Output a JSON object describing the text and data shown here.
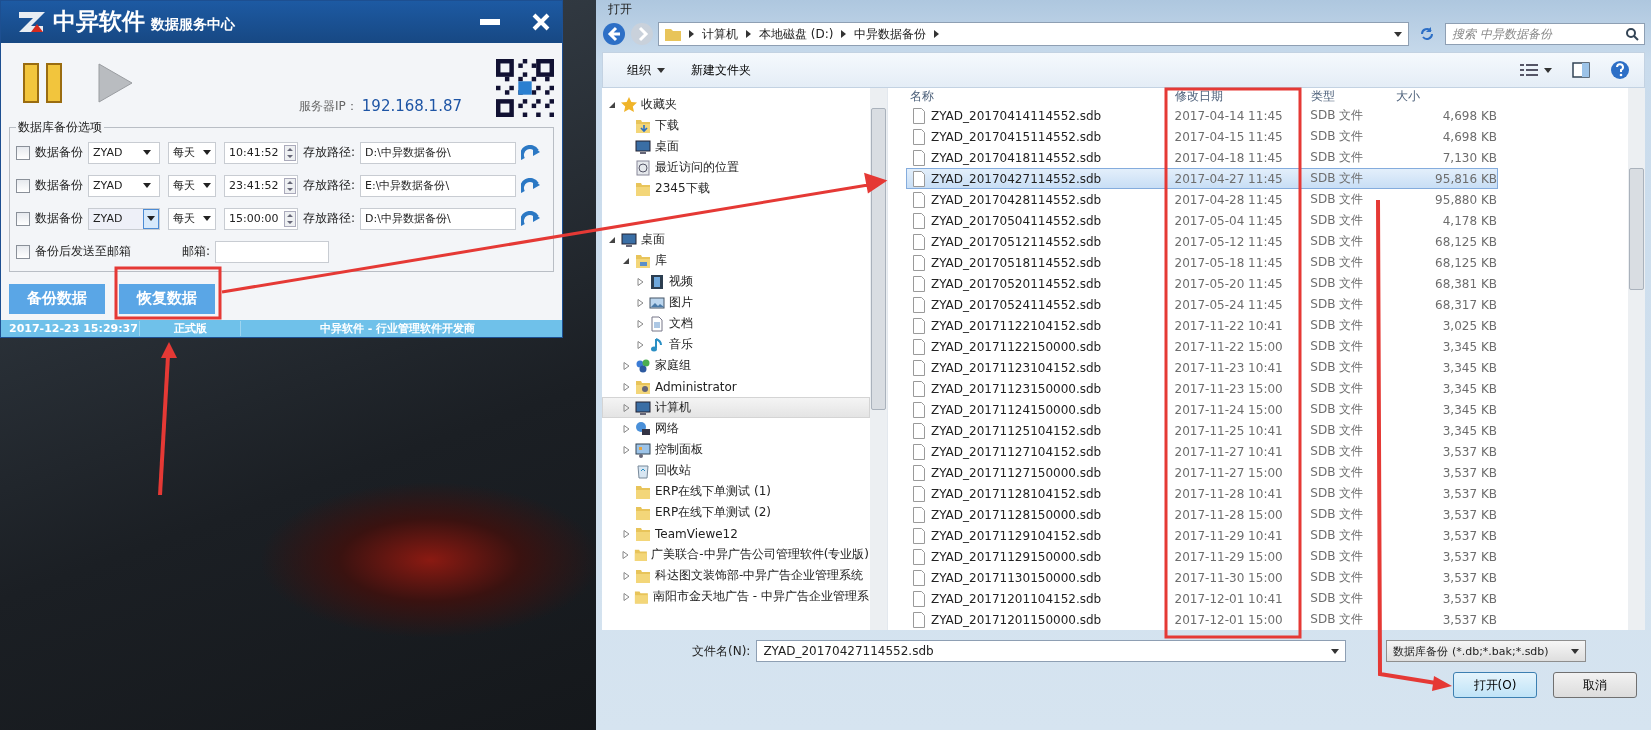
{
  "app_window": {
    "logo_text": "中异软件",
    "subtitle": "数据服务中心",
    "server_ip_label": "服务器IP：",
    "server_ip": "192.168.1.87",
    "group_title": "数据库备份选项",
    "backup_rows": [
      {
        "checked": false,
        "label": "数据备份",
        "database": "ZYAD",
        "combo_focused": false,
        "frequency": "每天",
        "time": "10:41:52",
        "path_label": "存放路径:",
        "path": "D:\\中异数据备份\\"
      },
      {
        "checked": false,
        "label": "数据备份",
        "database": "ZYAD",
        "combo_focused": false,
        "frequency": "每天",
        "time": "23:41:52",
        "path_label": "存放路径:",
        "path": "E:\\中异数据备份\\"
      },
      {
        "checked": false,
        "label": "数据备份",
        "database": "ZYAD",
        "combo_focused": true,
        "frequency": "每天",
        "time": "15:00:00",
        "path_label": "存放路径:",
        "path": "D:\\中异数据备份\\"
      }
    ],
    "email_option": {
      "checked": false,
      "label": "备份后发送至邮箱"
    },
    "email_label": "邮箱:",
    "buttons": [
      "备份数据",
      "恢复数据"
    ],
    "status_bar": [
      "2017-12-23 15:29:37",
      "正式版",
      "中异软件 - 行业管理软件开发商"
    ]
  },
  "dialog": {
    "title": "打开",
    "breadcrumb": [
      "计算机",
      "本地磁盘 (D:)",
      "中异数据备份"
    ],
    "search_placeholder": "搜索 中异数据备份",
    "toolbar": [
      "组织",
      "新建文件夹"
    ],
    "nav_tree": [
      {
        "label": "收藏夹",
        "kind": "star",
        "expanded": true,
        "selected": false,
        "children": [
          {
            "label": "下载",
            "kind": "download",
            "selected": false
          },
          {
            "label": "桌面",
            "kind": "desktop",
            "selected": false
          },
          {
            "label": "最近访问的位置",
            "kind": "recent",
            "selected": false
          },
          {
            "label": "2345下载",
            "kind": "folder",
            "selected": false
          }
        ]
      },
      {
        "label": "桌面",
        "kind": "desktop",
        "expanded": true,
        "selected": false,
        "children": [
          {
            "label": "库",
            "kind": "library",
            "expanded": true,
            "selected": false,
            "children": [
              {
                "label": "视频",
                "kind": "video",
                "expanded": false,
                "selected": false
              },
              {
                "label": "图片",
                "kind": "picture",
                "expanded": false,
                "selected": false
              },
              {
                "label": "文档",
                "kind": "document",
                "expanded": false,
                "selected": false
              },
              {
                "label": "音乐",
                "kind": "music",
                "expanded": false,
                "selected": false
              }
            ]
          },
          {
            "label": "家庭组",
            "kind": "homegroup",
            "expanded": false,
            "selected": false
          },
          {
            "label": "Administrator",
            "kind": "user",
            "expanded": false,
            "selected": false
          },
          {
            "label": "计算机",
            "kind": "computer",
            "expanded": false,
            "selected": true
          },
          {
            "label": "网络",
            "kind": "network",
            "expanded": false,
            "selected": false
          },
          {
            "label": "控制面板",
            "kind": "control",
            "expanded": false,
            "selected": false
          },
          {
            "label": "回收站",
            "kind": "recycle",
            "selected": false
          },
          {
            "label": "ERP在线下单测试 (1)",
            "kind": "folder",
            "selected": false
          },
          {
            "label": "ERP在线下单测试 (2)",
            "kind": "folder",
            "selected": false
          },
          {
            "label": "TeamViewe12",
            "kind": "folder",
            "expanded": false,
            "selected": false
          },
          {
            "label": "广美联合-中异广告公司管理软件(专业版)",
            "kind": "folder",
            "expanded": false,
            "selected": false
          },
          {
            "label": "科达图文装饰部-中异广告企业管理系统",
            "kind": "folder",
            "expanded": false,
            "selected": false
          },
          {
            "label": "南阳市金天地广告 - 中异广告企业管理系",
            "kind": "folder",
            "expanded": false,
            "selected": false
          }
        ]
      }
    ],
    "columns": [
      "名称",
      "修改日期",
      "类型",
      "大小"
    ],
    "files": [
      {
        "name": "ZYAD_20170414114552.sdb",
        "modified": "2017-04-14 11:45",
        "type": "SDB 文件",
        "size": "4,698 KB",
        "selected": false
      },
      {
        "name": "ZYAD_20170415114552.sdb",
        "modified": "2017-04-15 11:45",
        "type": "SDB 文件",
        "size": "4,698 KB",
        "selected": false
      },
      {
        "name": "ZYAD_20170418114552.sdb",
        "modified": "2017-04-18 11:45",
        "type": "SDB 文件",
        "size": "7,130 KB",
        "selected": false
      },
      {
        "name": "ZYAD_20170427114552.sdb",
        "modified": "2017-04-27 11:45",
        "type": "SDB 文件",
        "size": "95,816 KB",
        "selected": true
      },
      {
        "name": "ZYAD_20170428114552.sdb",
        "modified": "2017-04-28 11:45",
        "type": "SDB 文件",
        "size": "95,880 KB",
        "selected": false
      },
      {
        "name": "ZYAD_20170504114552.sdb",
        "modified": "2017-05-04 11:45",
        "type": "SDB 文件",
        "size": "4,178 KB",
        "selected": false
      },
      {
        "name": "ZYAD_20170512114552.sdb",
        "modified": "2017-05-12 11:45",
        "type": "SDB 文件",
        "size": "68,125 KB",
        "selected": false
      },
      {
        "name": "ZYAD_20170518114552.sdb",
        "modified": "2017-05-18 11:45",
        "type": "SDB 文件",
        "size": "68,125 KB",
        "selected": false
      },
      {
        "name": "ZYAD_20170520114552.sdb",
        "modified": "2017-05-20 11:45",
        "type": "SDB 文件",
        "size": "68,381 KB",
        "selected": false
      },
      {
        "name": "ZYAD_20170524114552.sdb",
        "modified": "2017-05-24 11:45",
        "type": "SDB 文件",
        "size": "68,317 KB",
        "selected": false
      },
      {
        "name": "ZYAD_20171122104152.sdb",
        "modified": "2017-11-22 10:41",
        "type": "SDB 文件",
        "size": "3,025 KB",
        "selected": false
      },
      {
        "name": "ZYAD_20171122150000.sdb",
        "modified": "2017-11-22 15:00",
        "type": "SDB 文件",
        "size": "3,345 KB",
        "selected": false
      },
      {
        "name": "ZYAD_20171123104152.sdb",
        "modified": "2017-11-23 10:41",
        "type": "SDB 文件",
        "size": "3,345 KB",
        "selected": false
      },
      {
        "name": "ZYAD_20171123150000.sdb",
        "modified": "2017-11-23 15:00",
        "type": "SDB 文件",
        "size": "3,345 KB",
        "selected": false
      },
      {
        "name": "ZYAD_20171124150000.sdb",
        "modified": "2017-11-24 15:00",
        "type": "SDB 文件",
        "size": "3,345 KB",
        "selected": false
      },
      {
        "name": "ZYAD_20171125104152.sdb",
        "modified": "2017-11-25 10:41",
        "type": "SDB 文件",
        "size": "3,345 KB",
        "selected": false
      },
      {
        "name": "ZYAD_20171127104152.sdb",
        "modified": "2017-11-27 10:41",
        "type": "SDB 文件",
        "size": "3,537 KB",
        "selected": false
      },
      {
        "name": "ZYAD_20171127150000.sdb",
        "modified": "2017-11-27 15:00",
        "type": "SDB 文件",
        "size": "3,537 KB",
        "selected": false
      },
      {
        "name": "ZYAD_20171128104152.sdb",
        "modified": "2017-11-28 10:41",
        "type": "SDB 文件",
        "size": "3,537 KB",
        "selected": false
      },
      {
        "name": "ZYAD_20171128150000.sdb",
        "modified": "2017-11-28 15:00",
        "type": "SDB 文件",
        "size": "3,537 KB",
        "selected": false
      },
      {
        "name": "ZYAD_20171129104152.sdb",
        "modified": "2017-11-29 10:41",
        "type": "SDB 文件",
        "size": "3,537 KB",
        "selected": false
      },
      {
        "name": "ZYAD_20171129150000.sdb",
        "modified": "2017-11-29 15:00",
        "type": "SDB 文件",
        "size": "3,537 KB",
        "selected": false
      },
      {
        "name": "ZYAD_20171130150000.sdb",
        "modified": "2017-11-30 15:00",
        "type": "SDB 文件",
        "size": "3,537 KB",
        "selected": false
      },
      {
        "name": "ZYAD_20171201104152.sdb",
        "modified": "2017-12-01 10:41",
        "type": "SDB 文件",
        "size": "3,537 KB",
        "selected": false
      },
      {
        "name": "ZYAD_20171201150000.sdb",
        "modified": "2017-12-01 15:00",
        "type": "SDB 文件",
        "size": "3,537 KB",
        "selected": false
      }
    ],
    "filename_label": "文件名(N):",
    "filename": "ZYAD_20170427114552.sdb",
    "filter": "数据库备份 (*.db;*.bak;*.sdb)",
    "open_button": "打开(O)",
    "cancel_button": "取消"
  }
}
